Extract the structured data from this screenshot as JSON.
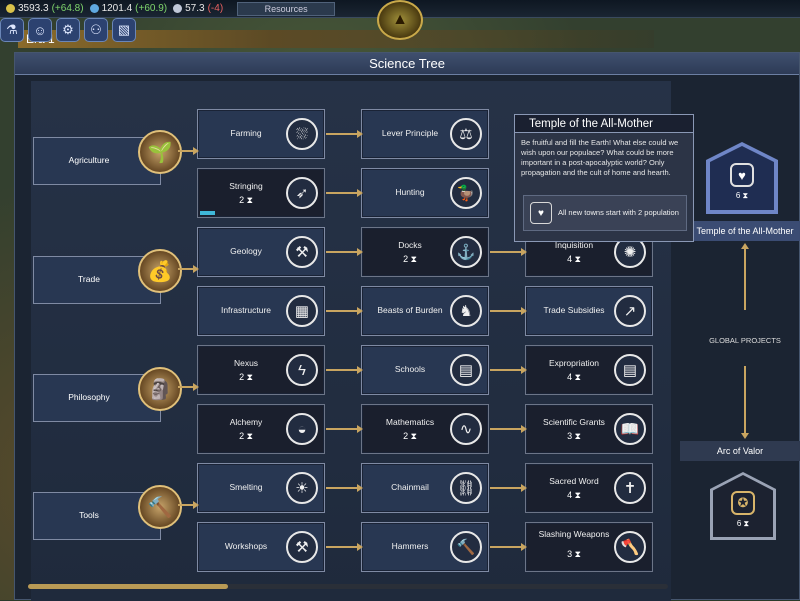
{
  "hud": {
    "resources": [
      {
        "value": "3593.3",
        "delta": "(+64.8)",
        "color": "#d9c24a",
        "delta_kind": "pos"
      },
      {
        "value": "1201.4",
        "delta": "(+60.9)",
        "color": "#5fa8e0",
        "delta_kind": "pos"
      },
      {
        "value": "57.3",
        "delta": "(-4)",
        "color": "#c0c8d8",
        "delta_kind": "neg"
      }
    ],
    "resources_button": "Resources",
    "emblem_icon": "eye-pyramid-icon",
    "icons": [
      "flask-icon",
      "person-icon",
      "gears-icon",
      "people-icon",
      "map-icon"
    ]
  },
  "panel": {
    "title": "Science Tree"
  },
  "era": {
    "label": "Era 1"
  },
  "categories": [
    {
      "label": "Agriculture",
      "icon": "sprout-hands-icon",
      "glyph": "🌱"
    },
    {
      "label": "Trade",
      "icon": "money-bag-icon",
      "glyph": "💰"
    },
    {
      "label": "Philosophy",
      "icon": "bust-statue-icon",
      "glyph": "🗿"
    },
    {
      "label": "Tools",
      "icon": "saw-hammer-icon",
      "glyph": "🔨"
    }
  ],
  "nodes": {
    "farming": {
      "label": "Farming",
      "icon": "field-icon",
      "glyph": "⛆"
    },
    "stringing": {
      "label": "Stringing",
      "turns": "2 ⧗",
      "icon": "bow-icon",
      "glyph": "➶",
      "progress": 0.12
    },
    "geology": {
      "label": "Geology",
      "icon": "pickaxes-icon",
      "glyph": "⚒"
    },
    "infrastructure": {
      "label": "Infrastructure",
      "icon": "buildings-icon",
      "glyph": "▦"
    },
    "nexus": {
      "label": "Nexus",
      "turns": "2 ⧗",
      "icon": "lightning-icon",
      "glyph": "ϟ"
    },
    "alchemy": {
      "label": "Alchemy",
      "turns": "2 ⧗",
      "icon": "mortar-icon",
      "glyph": "◒"
    },
    "smelting": {
      "label": "Smelting",
      "icon": "lightbulb-icon",
      "glyph": "☀"
    },
    "workshops": {
      "label": "Workshops",
      "icon": "anvil-icon",
      "glyph": "⚒"
    },
    "lever": {
      "label": "Lever Principle",
      "icon": "lever-icon",
      "glyph": "⚖"
    },
    "hunting": {
      "label": "Hunting",
      "icon": "duck-icon",
      "glyph": "🦆"
    },
    "docks": {
      "label": "Docks",
      "turns": "2 ⧗",
      "icon": "dock-icon",
      "glyph": "⚓"
    },
    "beasts": {
      "label": "Beasts of Burden",
      "icon": "horse-icon",
      "glyph": "♞"
    },
    "schools": {
      "label": "Schools",
      "icon": "blackboard-icon",
      "glyph": "▤"
    },
    "mathematics": {
      "label": "Mathematics",
      "turns": "2 ⧗",
      "icon": "graph-icon",
      "glyph": "∿"
    },
    "chainmail": {
      "label": "Chainmail",
      "icon": "chain-icon",
      "glyph": "⛓"
    },
    "hammers": {
      "label": "Hammers",
      "icon": "hammer-icon",
      "glyph": "🔨"
    },
    "inquisition": {
      "label": "Inquisition",
      "turns": "4 ⧗",
      "icon": "sun-eye-icon",
      "glyph": "✺"
    },
    "trade_subsidies": {
      "label": "Trade Subsidies",
      "icon": "coins-chart-icon",
      "glyph": "↗"
    },
    "expropriation": {
      "label": "Expropriation",
      "turns": "4 ⧗",
      "icon": "document-icon",
      "glyph": "▤"
    },
    "scientific_grants": {
      "label": "Scientific Grants",
      "turns": "3 ⧗",
      "icon": "book-icon",
      "glyph": "📖"
    },
    "sacred_word": {
      "label": "Sacred Word",
      "turns": "4 ⧗",
      "icon": "bible-icon",
      "glyph": "✝"
    },
    "slashing_weapons": {
      "label": "Slashing Weapons",
      "turns": "3 ⧗",
      "icon": "axe-icon",
      "glyph": "🪓"
    }
  },
  "tooltip": {
    "title": "Temple of the All-Mother",
    "body": "Be fruitful and fill the Earth! What else could we wish upon our populace? What could be more important in a post-apocalyptic world? Only propagation and the cult of home and hearth.",
    "effect": "All new towns start with 2 population",
    "effect_icon": "heart-hands-icon"
  },
  "global_projects": {
    "heading": "GLOBAL PROJECTS",
    "selected": {
      "label": "Temple of the All-Mother",
      "turns": "6 ⧗",
      "icon": "heart-hands-icon"
    },
    "next": {
      "label": "Arc of Valor",
      "turns": "6 ⧗",
      "icon": "medal-icon"
    }
  }
}
